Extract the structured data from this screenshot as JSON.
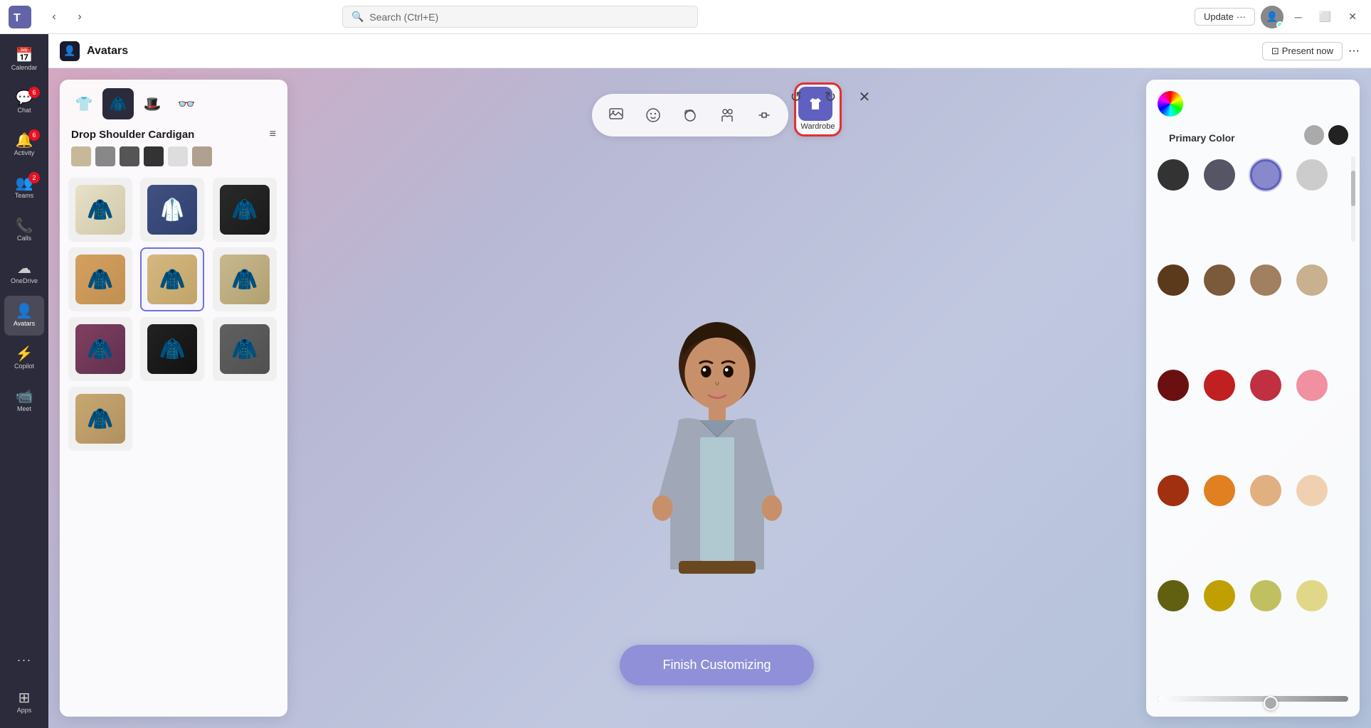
{
  "titlebar": {
    "search_placeholder": "Search (Ctrl+E)",
    "update_label": "Update",
    "more_label": "···",
    "minimize_label": "─",
    "maximize_label": "⬜",
    "close_label": "✕"
  },
  "app_header": {
    "title": "Avatars",
    "present_label": "Present now",
    "more_label": "···"
  },
  "sidebar": {
    "items": [
      {
        "id": "calendar",
        "label": "Calendar",
        "icon": "📅",
        "badge": null
      },
      {
        "id": "chat",
        "label": "Chat",
        "icon": "💬",
        "badge": "6"
      },
      {
        "id": "activity",
        "label": "Activity",
        "icon": "🔔",
        "badge": "6"
      },
      {
        "id": "teams",
        "label": "Teams",
        "icon": "👥",
        "badge": "2"
      },
      {
        "id": "calls",
        "label": "Calls",
        "icon": "📞",
        "badge": null
      },
      {
        "id": "onedrive",
        "label": "OneDrive",
        "icon": "☁",
        "badge": null
      },
      {
        "id": "avatars",
        "label": "Avatars",
        "icon": "👤",
        "badge": null
      },
      {
        "id": "copilot",
        "label": "Copilot",
        "icon": "⚡",
        "badge": null
      },
      {
        "id": "meet",
        "label": "Meet",
        "icon": "📹",
        "badge": null
      },
      {
        "id": "more",
        "label": "···",
        "icon": "···",
        "badge": null
      },
      {
        "id": "apps",
        "label": "Apps",
        "icon": "⊞",
        "badge": null
      }
    ]
  },
  "tool_tabs": [
    {
      "id": "background",
      "icon": "🖼",
      "label": ""
    },
    {
      "id": "face",
      "icon": "😊",
      "label": ""
    },
    {
      "id": "hair",
      "icon": "💇",
      "label": ""
    },
    {
      "id": "body",
      "icon": "👫",
      "label": ""
    },
    {
      "id": "accessories",
      "icon": "✋",
      "label": ""
    },
    {
      "id": "wardrobe",
      "icon": "👕",
      "label": "Wardrobe",
      "active": true
    }
  ],
  "wardrobe": {
    "tabs": [
      {
        "id": "tops",
        "icon": "👕",
        "active": false
      },
      {
        "id": "full",
        "icon": "🧥",
        "active": true
      },
      {
        "id": "hat",
        "icon": "🎩",
        "active": false
      },
      {
        "id": "glasses",
        "icon": "👓",
        "active": false
      }
    ],
    "title": "Drop Shoulder Cardigan",
    "color_swatches": [
      "#c8b89a",
      "#888",
      "#555",
      "#333",
      "#ddd",
      "#b0a090"
    ],
    "items": [
      {
        "id": 1,
        "emoji": "🧥",
        "color": "#d4c9a8",
        "selected": false
      },
      {
        "id": 2,
        "emoji": "🥼",
        "color": "#4070a0",
        "selected": false
      },
      {
        "id": 3,
        "emoji": "🧥",
        "color": "#333",
        "selected": false
      },
      {
        "id": 4,
        "emoji": "🧥",
        "color": "#d4a060",
        "selected": false
      },
      {
        "id": 5,
        "emoji": "🧥",
        "color": "#c8a870",
        "selected": true
      },
      {
        "id": 6,
        "emoji": "🧥",
        "color": "#c8b890",
        "selected": false
      },
      {
        "id": 7,
        "emoji": "🧥",
        "color": "#a04060",
        "selected": false
      },
      {
        "id": 8,
        "emoji": "🧥",
        "color": "#222",
        "selected": false
      },
      {
        "id": 9,
        "emoji": "🧥",
        "color": "#666",
        "selected": false
      },
      {
        "id": 10,
        "emoji": "🧥",
        "color": "#c8a870",
        "selected": false
      }
    ]
  },
  "color_panel": {
    "title": "Primary Color",
    "top_swatches": [
      {
        "color": "#aaaaaa",
        "selected": false
      },
      {
        "color": "#222222",
        "selected": false
      }
    ],
    "colors": [
      {
        "color": "#333333",
        "selected": false
      },
      {
        "color": "#555566",
        "selected": false
      },
      {
        "color": "#8888cc",
        "selected": true
      },
      {
        "color": "#cccccc",
        "selected": false
      },
      {
        "color": "#5a3a1a",
        "selected": false
      },
      {
        "color": "#7a5a3a",
        "selected": false
      },
      {
        "color": "#a08060",
        "selected": false
      },
      {
        "color": "#c8b090",
        "selected": false
      },
      {
        "color": "#6a1010",
        "selected": false
      },
      {
        "color": "#c02020",
        "selected": false
      },
      {
        "color": "#c03040",
        "selected": false
      },
      {
        "color": "#f090a0",
        "selected": false
      },
      {
        "color": "#a03010",
        "selected": false
      },
      {
        "color": "#e08020",
        "selected": false
      },
      {
        "color": "#e0b080",
        "selected": false
      },
      {
        "color": "#f0d0b0",
        "selected": false
      },
      {
        "color": "#606010",
        "selected": false
      },
      {
        "color": "#c0a000",
        "selected": false
      },
      {
        "color": "#c0c060",
        "selected": false
      },
      {
        "color": "#e0d888",
        "selected": false
      }
    ],
    "slider_value": 60
  },
  "finish_button": {
    "label": "Finish Customizing"
  },
  "editor_controls": {
    "undo": "↺",
    "redo": "↻",
    "close": "✕"
  }
}
